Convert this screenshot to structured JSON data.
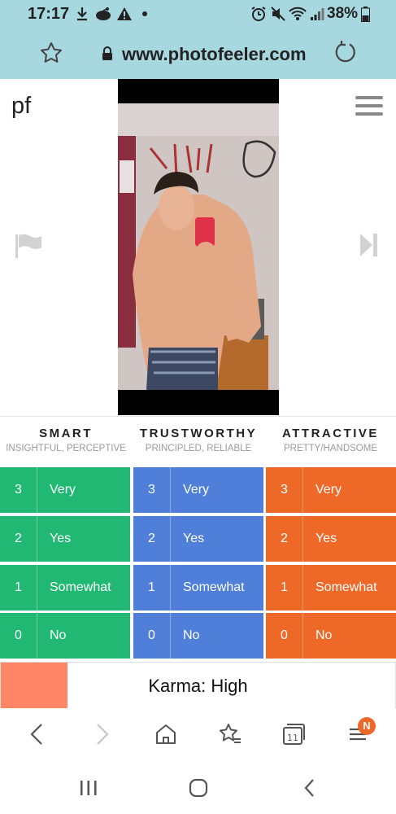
{
  "status_bar": {
    "time": "17:17",
    "battery": "38%"
  },
  "browser": {
    "url": "www.photofeeler.com",
    "icons": {
      "favorite": "star-icon",
      "lock": "lock-icon",
      "reload": "reload-icon"
    }
  },
  "site": {
    "logo": "pf"
  },
  "categories": [
    {
      "title": "SMART",
      "subtitle": "INSIGHTFUL, PERCEPTIVE",
      "color": "#20b872"
    },
    {
      "title": "TRUSTWORTHY",
      "subtitle": "PRINCIPLED, RELIABLE",
      "color": "#4f7fd8"
    },
    {
      "title": "ATTRACTIVE",
      "subtitle": "PRETTY/HANDSOME",
      "color": "#ee6828"
    }
  ],
  "ratings": [
    {
      "value": "3",
      "label": "Very"
    },
    {
      "value": "2",
      "label": "Yes"
    },
    {
      "value": "1",
      "label": "Somewhat"
    },
    {
      "value": "0",
      "label": "No"
    }
  ],
  "karma": {
    "text": "Karma: High",
    "fill_fraction": 0.17,
    "color": "#ff8566"
  },
  "bottom_nav": {
    "tabs_count": "11",
    "menu_badge": "N"
  }
}
